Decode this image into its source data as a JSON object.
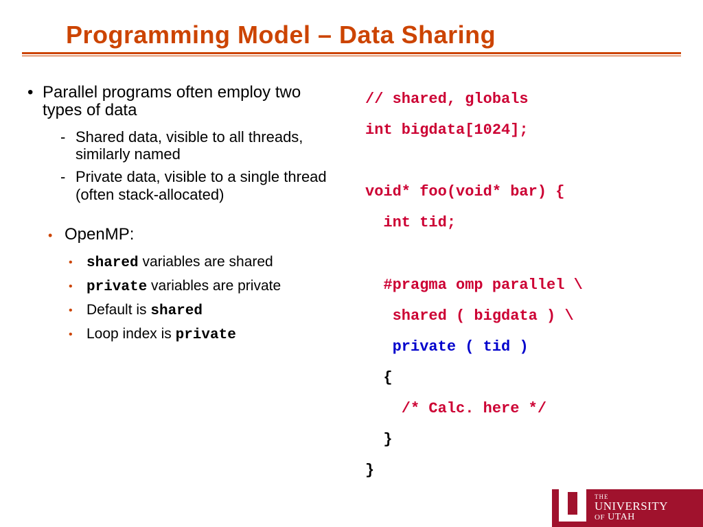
{
  "title": "Programming Model – Data Sharing",
  "left": {
    "b1": "Parallel programs often employ two types of data",
    "b1_sub1": "Shared data, visible to all threads, similarly named",
    "b1_sub2": "Private data, visible to a single thread (often stack-allocated)",
    "b2": "OpenMP:",
    "b2_s1a": "shared",
    "b2_s1b": " variables are shared",
    "b2_s2a": "private",
    "b2_s2b": " variables are private",
    "b2_s3a": "Default is ",
    "b2_s3b": "shared",
    "b2_s4a": "Loop index is ",
    "b2_s4b": "private"
  },
  "code": {
    "l1": "// shared, globals",
    "l2": "int bigdata[1024];",
    "l3": "",
    "l4": "void* foo(void* bar) {",
    "l5": "  int tid;",
    "l6": "",
    "l7": "  #pragma omp parallel \\",
    "l8": "   shared ( bigdata ) \\",
    "l9a": "   ",
    "l9b": "private ( tid )",
    "l10": "  {",
    "l11": "    /* Calc. here */",
    "l12": "  }",
    "l13": "}"
  },
  "logo": {
    "the": "THE",
    "uni": "UNIVERSITY",
    "ut_of": "OF",
    "ut": " UTAH"
  }
}
